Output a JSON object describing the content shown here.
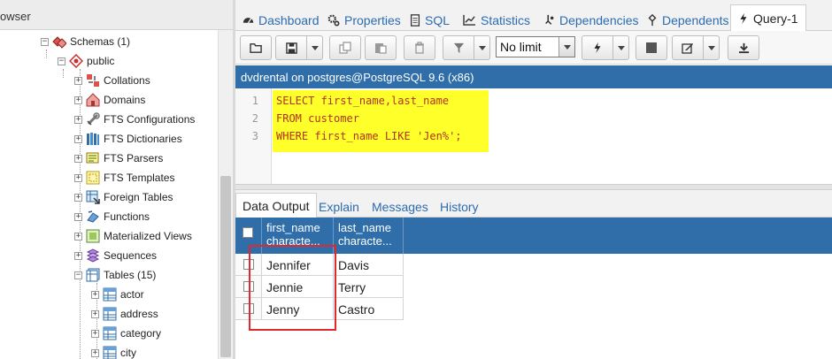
{
  "browser": {
    "title": "owser",
    "tree": [
      {
        "label": "Schemas (1)",
        "icon": "schemas-icon",
        "expander": "−"
      },
      {
        "label": "public",
        "icon": "schema-icon",
        "expander": "−"
      },
      {
        "label": "Collations",
        "icon": "collations-icon",
        "expander": "+"
      },
      {
        "label": "Domains",
        "icon": "domains-icon",
        "expander": "+"
      },
      {
        "label": "FTS Configurations",
        "icon": "fts-configurations-icon",
        "expander": "+"
      },
      {
        "label": "FTS Dictionaries",
        "icon": "fts-dictionaries-icon",
        "expander": "+"
      },
      {
        "label": "FTS Parsers",
        "icon": "fts-parsers-icon",
        "expander": "+"
      },
      {
        "label": "FTS Templates",
        "icon": "fts-templates-icon",
        "expander": "+"
      },
      {
        "label": "Foreign Tables",
        "icon": "foreign-tables-icon",
        "expander": "+"
      },
      {
        "label": "Functions",
        "icon": "functions-icon",
        "expander": "+"
      },
      {
        "label": "Materialized Views",
        "icon": "materialized-views-icon",
        "expander": "+"
      },
      {
        "label": "Sequences",
        "icon": "sequences-icon",
        "expander": "+"
      },
      {
        "label": "Tables (15)",
        "icon": "tables-icon",
        "expander": "−"
      },
      {
        "label": "actor",
        "icon": "table-icon",
        "expander": "+"
      },
      {
        "label": "address",
        "icon": "table-icon",
        "expander": "+"
      },
      {
        "label": "category",
        "icon": "table-icon",
        "expander": "+"
      },
      {
        "label": "city",
        "icon": "table-icon",
        "expander": "+"
      }
    ]
  },
  "tabs": [
    {
      "label": "Dashboard",
      "icon": "dashboard-icon"
    },
    {
      "label": "Properties",
      "icon": "properties-icon"
    },
    {
      "label": "SQL",
      "icon": "sql-icon"
    },
    {
      "label": "Statistics",
      "icon": "statistics-icon"
    },
    {
      "label": "Dependencies",
      "icon": "dependencies-icon"
    },
    {
      "label": "Dependents",
      "icon": "dependents-icon"
    },
    {
      "label": "Query-1",
      "icon": "query-icon",
      "active": true
    }
  ],
  "toolbar": {
    "limit_value": "No limit",
    "buttons": [
      "open-file-icon",
      "save-icon",
      "copy-icon",
      "paste-icon",
      "delete-icon",
      "filter-icon",
      "execute-icon",
      "stop-icon",
      "edit-icon",
      "download-icon"
    ]
  },
  "connection": {
    "label": "dvdrental on postgres@PostgreSQL 9.6 (x86)"
  },
  "editor": {
    "lines": [
      {
        "num": "1",
        "text": "SELECT first_name,last_name"
      },
      {
        "num": "2",
        "text": "FROM customer"
      },
      {
        "num": "3",
        "text": "WHERE first_name LIKE 'Jen%';"
      }
    ],
    "highlight_color": "#ffff2a"
  },
  "output_tabs": [
    {
      "label": "Data Output",
      "active": true
    },
    {
      "label": "Explain"
    },
    {
      "label": "Messages"
    },
    {
      "label": "History"
    }
  ],
  "grid": {
    "columns": [
      {
        "name": "first_name",
        "type": "characte..."
      },
      {
        "name": "last_name",
        "type": "characte..."
      }
    ],
    "rows": [
      [
        "Jennifer",
        "Davis"
      ],
      [
        "Jennie",
        "Terry"
      ],
      [
        "Jenny",
        "Castro"
      ]
    ]
  },
  "colors": {
    "accent": "#2f6ea8",
    "link": "#2b6cb0",
    "annotation": "#e0292f"
  }
}
